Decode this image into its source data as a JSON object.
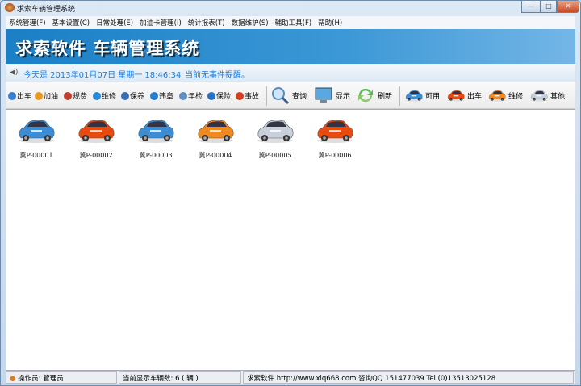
{
  "window": {
    "title": "求索车辆管理系统",
    "controls": [
      "minimize",
      "maximize",
      "close"
    ]
  },
  "menu": [
    "系统管理(F)",
    "基本设置(C)",
    "日常处理(E)",
    "加油卡管理(I)",
    "统计报表(T)",
    "数据维护(S)",
    "辅助工具(F)",
    "帮助(H)"
  ],
  "banner": {
    "title": "求索软件  车辆管理系统"
  },
  "info": {
    "date": "今天是 2013年01月07日 星期一 18:46:34",
    "event": "当前无事件提醒。"
  },
  "toolbar": {
    "small": [
      {
        "label": "出车",
        "icon": "car-out-icon",
        "color": "#3a7fd0"
      },
      {
        "label": "加油",
        "icon": "fuel-icon",
        "color": "#e89a20"
      },
      {
        "label": "规费",
        "icon": "fee-icon",
        "color": "#c04030"
      },
      {
        "label": "维修",
        "icon": "repair-icon",
        "color": "#2a8ad8"
      },
      {
        "label": "保养",
        "icon": "maintenance-icon",
        "color": "#3a70b0"
      },
      {
        "label": "违章",
        "icon": "violation-icon",
        "color": "#2a80d0"
      },
      {
        "label": "年检",
        "icon": "inspection-icon",
        "color": "#6090c0"
      },
      {
        "label": "保险",
        "icon": "insurance-icon",
        "color": "#2a70c0"
      },
      {
        "label": "事故",
        "icon": "accident-icon",
        "color": "#d04020"
      }
    ],
    "big": [
      {
        "label": "查询",
        "icon": "search-icon"
      },
      {
        "label": "显示",
        "icon": "monitor-icon"
      },
      {
        "label": "刷新",
        "icon": "refresh-icon"
      }
    ],
    "filters": [
      {
        "label": "可用",
        "color": "#3b8ed6"
      },
      {
        "label": "出车",
        "color": "#e84a10"
      },
      {
        "label": "维修",
        "color": "#f08a20"
      },
      {
        "label": "其他",
        "color": "#c8d0dc"
      }
    ]
  },
  "vehicles": [
    {
      "plate": "冀P-00001",
      "color": "#3b8ed6"
    },
    {
      "plate": "冀P-00002",
      "color": "#e84a10"
    },
    {
      "plate": "冀P-00003",
      "color": "#3b8ed6"
    },
    {
      "plate": "冀P-00004",
      "color": "#f08a20"
    },
    {
      "plate": "冀P-00005",
      "color": "#c8d0dc"
    },
    {
      "plate": "冀P-00006",
      "color": "#e84a10"
    }
  ],
  "status": {
    "operator": "操作员: 管理员",
    "count": "当前显示车辆数: 6 ( 辆 )",
    "company": "求索软件  http://www.xlq668.com   咨询QQ 151477039   Tel (0)13513025128"
  }
}
